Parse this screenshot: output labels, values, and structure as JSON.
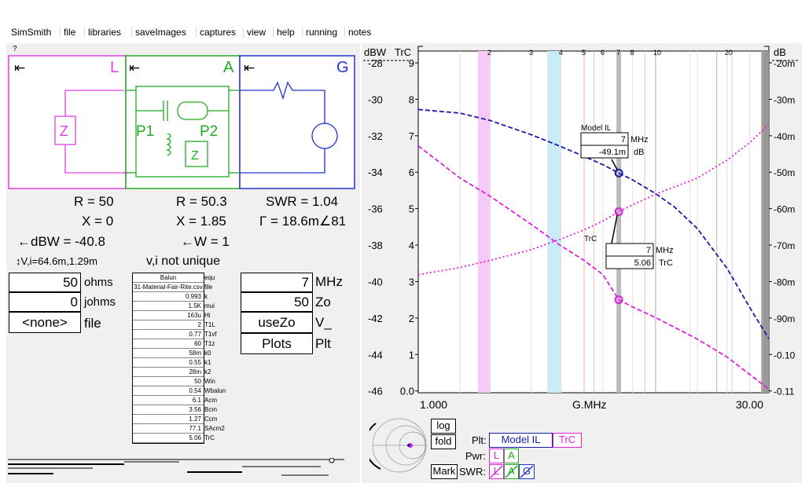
{
  "menu": [
    "SimSmith",
    "file",
    "libraries",
    "saveImages",
    "captures",
    "view",
    "help",
    "running",
    "notes"
  ],
  "help_mark": "?",
  "circuit": {
    "blocks": {
      "L": "L",
      "A": "A",
      "G": "G"
    },
    "arrow": "⇤",
    "p1": "P1",
    "p2": "P2",
    "z": "Z",
    "colors": {
      "L": "#e040e0",
      "A": "#22aa22",
      "G": "#2233cc"
    }
  },
  "readouts": {
    "r_load": "R = 50",
    "x_load": "X = 0",
    "dbw": "←dBW = -40.8",
    "vi": "↕V,i=64.6m,1.29m",
    "r_a": "R = 50.3",
    "x_a": "X = 1.85",
    "w": "←W = 1",
    "vi_note": "v,i not unique",
    "swr": "SWR = 1.04",
    "gamma": "Γ = 18.6m∠81"
  },
  "load_inputs": [
    {
      "value": "50",
      "unit": "ohms"
    },
    {
      "value": "0",
      "unit": "johms"
    },
    {
      "value": "<none>",
      "unit": "file"
    }
  ],
  "balun": {
    "rows": [
      {
        "value": "Balun",
        "label": "equ"
      },
      {
        "value": "31-Material-Fair-Rite.csv",
        "label": "file"
      },
      {
        "value": "0.993",
        "label": "k"
      },
      {
        "value": "1.5K",
        "label": "mui"
      },
      {
        "value": "163u",
        "label": "Hi"
      },
      {
        "value": "2",
        "label": "T1L"
      },
      {
        "value": "0.77",
        "label": "T1vf"
      },
      {
        "value": "60",
        "label": "T1z"
      },
      {
        "value": "58m",
        "label": "k0"
      },
      {
        "value": "0.55",
        "label": "k1"
      },
      {
        "value": "28m",
        "label": "k2"
      },
      {
        "value": "50",
        "label": "Win"
      },
      {
        "value": "0.54",
        "label": "Wbalun"
      },
      {
        "value": "6.1",
        "label": "Acm"
      },
      {
        "value": "3.56",
        "label": "Bcm"
      },
      {
        "value": "1.27",
        "label": "Ccm"
      },
      {
        "value": "77.1",
        "label": "SAcm2"
      },
      {
        "value": "5.06",
        "label": "TrC"
      }
    ]
  },
  "gen_inputs": [
    {
      "value": "7",
      "unit": "MHz"
    },
    {
      "value": "50",
      "unit": "Zo"
    },
    {
      "value": "useZo",
      "unit": "V_"
    },
    {
      "value": "Plots",
      "unit": "Plt"
    }
  ],
  "chart_labels": {
    "dbw": "dBW",
    "trc": "TrC",
    "db": "dB",
    "xname": "G.MHz",
    "xmin": "1.000",
    "xmax": "30.00",
    "top_ticks": [
      "2",
      "3",
      "4",
      "5",
      "6",
      "7",
      "8",
      "10",
      "20"
    ]
  },
  "chart_data": {
    "type": "line",
    "xlabel": "G.MHz",
    "xscale": "log",
    "xlim": [
      1,
      30
    ],
    "left_axis_dbw": {
      "label": "dBW",
      "ticks": [
        "-28",
        "-30",
        "-32",
        "-34",
        "-36",
        "-38",
        "-40",
        "-42",
        "-44",
        "-46"
      ]
    },
    "left_axis_trc": {
      "label": "TrC",
      "ticks": [
        "9",
        "8",
        "7",
        "6",
        "5",
        "4",
        "3",
        "2",
        "1",
        "0.0"
      ]
    },
    "right_axis_db": {
      "label": "dB",
      "ticks": [
        "-20m",
        "-30m",
        "-40m",
        "-50m",
        "-60m",
        "-70m",
        "-80m",
        "-90m",
        "-0.10",
        "-0.11"
      ]
    },
    "series": [
      {
        "name": "Model IL",
        "color": "#1a1aaa",
        "style": "dashed",
        "x": [
          1,
          1.5,
          2,
          3,
          4,
          5,
          6,
          7,
          8,
          10,
          12,
          15,
          20,
          25,
          30
        ],
        "y": [
          -0.0315,
          -0.0325,
          -0.0345,
          -0.0385,
          -0.0418,
          -0.0445,
          -0.0468,
          -0.0491,
          -0.051,
          -0.0548,
          -0.0585,
          -0.0645,
          -0.0755,
          -0.0865,
          -0.095
        ]
      },
      {
        "name": "TrC",
        "color": "#dd22dd",
        "style": "dashed",
        "x": [
          1,
          1.5,
          2,
          3,
          4,
          5,
          6,
          7,
          8,
          10,
          15,
          20,
          30
        ],
        "y": [
          6.9,
          6.0,
          5.5,
          4.7,
          4.1,
          3.7,
          3.3,
          2.6,
          2.4,
          2.1,
          1.5,
          1.0,
          0.1
        ]
      },
      {
        "name": "TrC-dotted",
        "color": "#dd22dd",
        "style": "dotted",
        "x": [
          1,
          1.5,
          2,
          3,
          4,
          5,
          6,
          7,
          8,
          10,
          15,
          20,
          25,
          30
        ],
        "y": [
          3.3,
          3.5,
          3.7,
          4.0,
          4.3,
          4.55,
          4.8,
          5.06,
          5.25,
          5.55,
          6.0,
          6.5,
          7.0,
          7.5
        ]
      }
    ],
    "cursor": {
      "x": 7,
      "model_il_label": "Model IL",
      "model_il_value": "7",
      "model_il_unit": "MHz",
      "model_il_db": "-49.1m",
      "model_il_db_unit": "dB",
      "trc_label": "TrC",
      "trc_freq": "7",
      "trc_freq_unit": "MHz",
      "trc_value": "5.06",
      "trc_unit": "TrC"
    },
    "bands": [
      1.8,
      3.5,
      7.0,
      10.1,
      14.0,
      18.1,
      21.0,
      24.9,
      28.0
    ],
    "grid": true
  },
  "smith_controls": {
    "log": "log",
    "fold": "fold",
    "mark": "Mark"
  },
  "plt": {
    "label": "Plt:",
    "model": "Model IL",
    "trc": "TrC",
    "pwr": "Pwr:",
    "swr": "SWR:",
    "l": "L",
    "a": "A",
    "g": "G"
  }
}
